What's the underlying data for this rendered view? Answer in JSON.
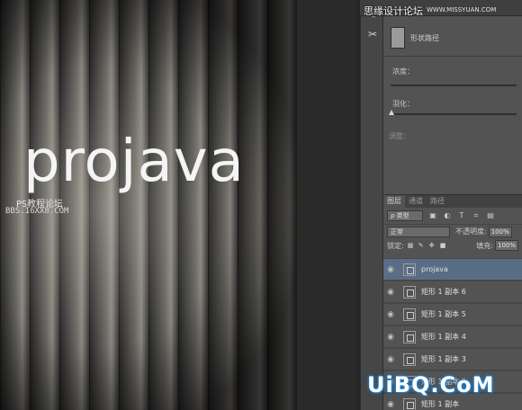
{
  "canvas": {
    "art_text": "projava",
    "watermark_line1": "PS教程论坛",
    "watermark_line2": "BBS.16XX8.COM",
    "stripe_count": 10
  },
  "tools": {
    "items": [
      {
        "icon": "paragraph-icon",
        "glyph": "¶"
      },
      {
        "icon": "tool-settings-icon",
        "glyph": "✂"
      }
    ]
  },
  "properties": {
    "path_label": "形状路径",
    "density_label": "浓度：",
    "feather_label": "羽化：",
    "feather_value": 0,
    "adjust_label": "调整："
  },
  "layers_panel": {
    "tabs": [
      {
        "label": "图层",
        "active": true
      },
      {
        "label": "通道",
        "active": false
      },
      {
        "label": "路径",
        "active": false
      }
    ],
    "filter_label": "ρ 类型",
    "blend_mode": "正常",
    "opacity_label": "不透明度:",
    "opacity_value": "100%",
    "lock_label": "锁定:",
    "fill_label": "填充:",
    "fill_value": "100%",
    "layers": [
      {
        "name": "projava",
        "selected": true
      },
      {
        "name": "矩形 1 副本 6",
        "selected": false
      },
      {
        "name": "矩形 1 副本 5",
        "selected": false
      },
      {
        "name": "矩形 1 副本 4",
        "selected": false
      },
      {
        "name": "矩形 1 副本 3",
        "selected": false
      },
      {
        "name": "矩形 1 副本 2",
        "selected": false
      },
      {
        "name": "矩形 1 副本",
        "selected": false
      }
    ]
  },
  "overlays": {
    "site_top": "思缘设计论坛",
    "site_top_url": "WWW.MISSYUAN.COM",
    "uibq": "UiBQ.CoM"
  },
  "colors": {
    "selected_layer": "#5a6d86",
    "panel_bg": "#535353",
    "uibq_glow": "#1c7fd0"
  }
}
